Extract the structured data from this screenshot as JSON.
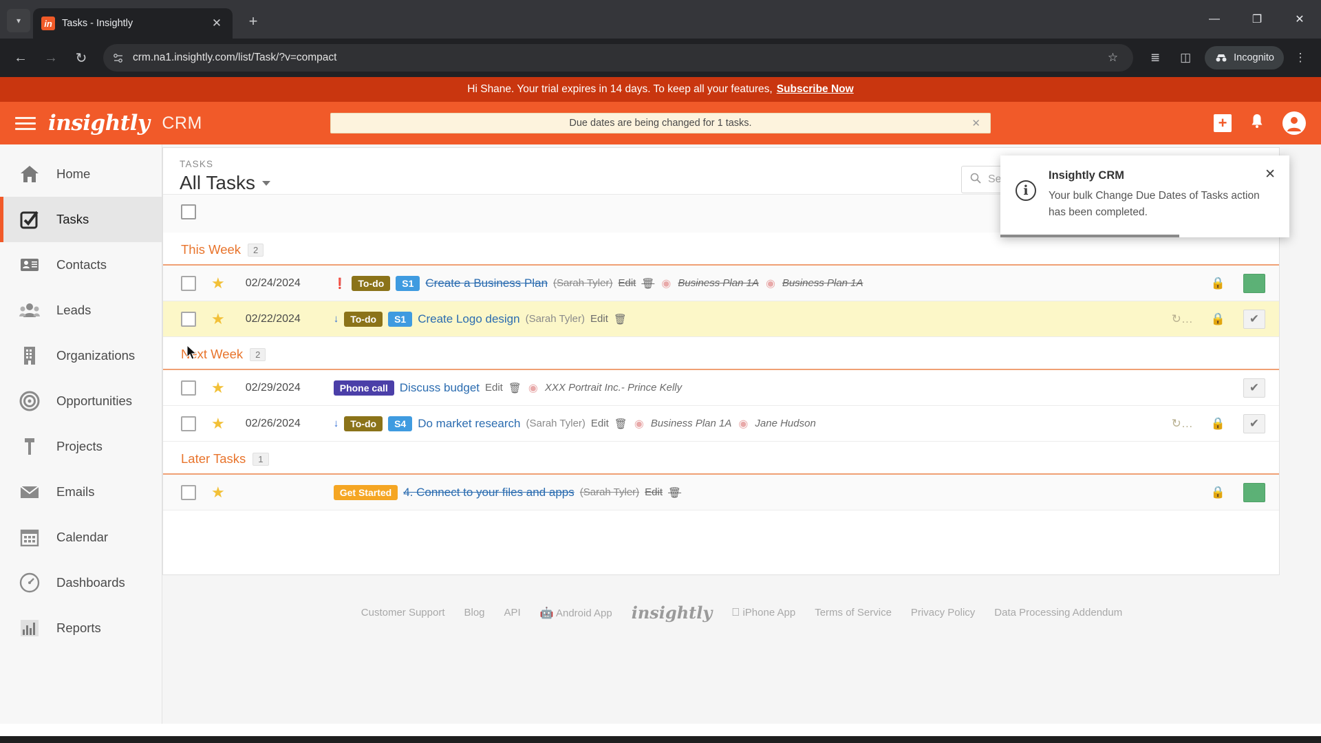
{
  "browser": {
    "tab_title": "Tasks - Insightly",
    "favicon_text": "in",
    "url": "crm.na1.insightly.com/list/Task/?v=compact",
    "new_tab_label": "+",
    "close_tab_label": "✕",
    "incognito_label": "Incognito",
    "back_icon": "←",
    "forward_icon": "→",
    "reload_icon": "↻",
    "minimize_icon": "—",
    "maximize_icon": "❐",
    "close_icon": "✕",
    "menu_icon": "⋮",
    "star_icon": "☆",
    "split_icon": "◫",
    "reading_list_icon": "≣"
  },
  "trial": {
    "message": "Hi Shane. Your trial expires in 14 days. To keep all your features,",
    "cta": "Subscribe Now"
  },
  "header": {
    "brand": "insightly",
    "product": "CRM",
    "alert_text": "Due dates are being changed for 1 tasks.",
    "alert_close": "✕",
    "add_icon": "+",
    "bell_icon": "🔔",
    "avatar_icon": "●"
  },
  "toast": {
    "title": "Insightly CRM",
    "message": "Your bulk Change Due Dates of Tasks action has been completed.",
    "close": "✕",
    "info_icon": "i"
  },
  "sidebar": {
    "items": [
      {
        "label": "Home",
        "icon": "home-icon",
        "active": false
      },
      {
        "label": "Tasks",
        "icon": "checkbox-icon",
        "active": true
      },
      {
        "label": "Contacts",
        "icon": "contact-card-icon",
        "active": false
      },
      {
        "label": "Leads",
        "icon": "people-icon",
        "active": false
      },
      {
        "label": "Organizations",
        "icon": "building-icon",
        "active": false
      },
      {
        "label": "Opportunities",
        "icon": "target-icon",
        "active": false
      },
      {
        "label": "Projects",
        "icon": "hammer-icon",
        "active": false
      },
      {
        "label": "Emails",
        "icon": "envelope-icon",
        "active": false
      },
      {
        "label": "Calendar",
        "icon": "calendar-icon",
        "active": false
      },
      {
        "label": "Dashboards",
        "icon": "gauge-icon",
        "active": false
      },
      {
        "label": "Reports",
        "icon": "bar-chart-icon",
        "active": false
      }
    ]
  },
  "list": {
    "kicker": "TASKS",
    "title": "All Tasks",
    "search_placeholder": "Search this list..",
    "search_value": "",
    "refresh_icon": "↻",
    "gear_icon": "⚙"
  },
  "groups": [
    {
      "title": "This Week",
      "count": "2",
      "rows": [
        {
          "date": "02/24/2024",
          "priority_icon": "❗",
          "priority_class": "high",
          "badges": [
            {
              "text": "To-do",
              "class": "todo"
            },
            {
              "text": "S1",
              "class": "s1"
            }
          ],
          "title": "Create a Business Plan",
          "owner": "(Sarah Tyler)",
          "edit": "Edit",
          "trash": "🗑",
          "related": "Business Plan 1A",
          "related2": "Business Plan 1A",
          "completed": true,
          "highlight": false,
          "alt": true,
          "show_recur": false,
          "show_lock": true,
          "check_green": true
        },
        {
          "date": "02/22/2024",
          "priority_icon": "↓",
          "priority_class": "low",
          "badges": [
            {
              "text": "To-do",
              "class": "todo"
            },
            {
              "text": "S1",
              "class": "s1"
            }
          ],
          "title": "Create Logo design",
          "owner": "(Sarah Tyler)",
          "edit": "Edit",
          "trash": "🗑",
          "related": "",
          "related2": "",
          "completed": false,
          "highlight": true,
          "alt": false,
          "show_recur": true,
          "show_lock": true,
          "check_green": false
        }
      ]
    },
    {
      "title": "Next Week",
      "count": "2",
      "rows": [
        {
          "date": "02/29/2024",
          "priority_icon": "",
          "priority_class": "",
          "badges": [
            {
              "text": "Phone call",
              "class": "phone"
            }
          ],
          "title": "Discuss budget",
          "owner": "",
          "edit": "Edit",
          "trash": "🗑",
          "related": "XXX Portrait Inc.- Prince Kelly",
          "related2": "",
          "completed": false,
          "highlight": false,
          "alt": false,
          "show_recur": false,
          "show_lock": false,
          "check_green": false
        },
        {
          "date": "02/26/2024",
          "priority_icon": "↓",
          "priority_class": "low",
          "badges": [
            {
              "text": "To-do",
              "class": "todo"
            },
            {
              "text": "S4",
              "class": "s1"
            }
          ],
          "title": "Do market research",
          "owner": "(Sarah Tyler)",
          "edit": "Edit",
          "trash": "🗑",
          "related": "Business Plan 1A",
          "related2": "Jane Hudson",
          "completed": false,
          "highlight": false,
          "alt": false,
          "show_recur": true,
          "show_lock": true,
          "check_green": false
        }
      ]
    },
    {
      "title": "Later Tasks",
      "count": "1",
      "rows": [
        {
          "date": "",
          "priority_icon": "",
          "priority_class": "",
          "badges": [
            {
              "text": "Get Started",
              "class": "started"
            }
          ],
          "title": "4. Connect to your files and apps",
          "owner": "(Sarah Tyler)",
          "edit": "Edit",
          "trash": "🗑",
          "related": "",
          "related2": "",
          "completed": true,
          "highlight": false,
          "alt": true,
          "show_recur": false,
          "show_lock": true,
          "check_green": true
        }
      ]
    }
  ],
  "footer": {
    "links": [
      "Customer Support",
      "Blog",
      "API",
      "Android App",
      "insightly",
      "iPhone App",
      "Terms of Service",
      "Privacy Policy",
      "Data Processing Addendum"
    ]
  }
}
